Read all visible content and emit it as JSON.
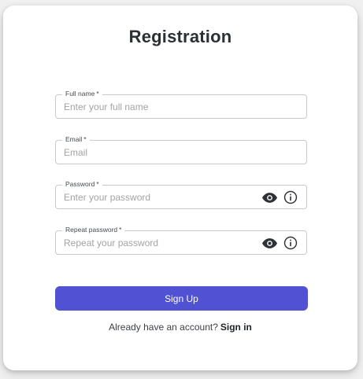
{
  "form": {
    "title": "Registration",
    "fields": [
      {
        "label": "Full name",
        "required_mark": "*",
        "placeholder": "Enter your full name",
        "value": ""
      },
      {
        "label": "Email",
        "required_mark": "*",
        "placeholder": "Email",
        "value": ""
      },
      {
        "label": "Password",
        "required_mark": "*",
        "placeholder": "Enter your password",
        "value": "",
        "icons": [
          "eye-icon",
          "info-icon"
        ]
      },
      {
        "label": "Repeat password",
        "required_mark": "*",
        "placeholder": "Repeat your password",
        "value": "",
        "icons": [
          "eye-icon",
          "info-icon"
        ]
      }
    ],
    "submit_label": "Sign Up",
    "footer_text": "Already have an account?",
    "footer_link": "Sign in"
  },
  "colors": {
    "accent": "#5151d3",
    "background": "#f0f0f0",
    "card": "#ffffff",
    "border": "#c9c9c9",
    "text": "#2b2f36"
  }
}
